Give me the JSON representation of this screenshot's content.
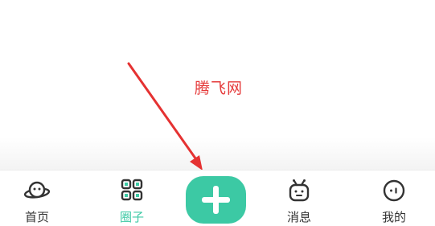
{
  "watermark": {
    "text": "腾飞网",
    "color": "#e53a3a"
  },
  "annotation": {
    "icon": "red-arrow",
    "color": "#e53232"
  },
  "tabbar": {
    "accent_color": "#3cc9a4",
    "items": [
      {
        "label": "首页",
        "icon": "planet-face-icon",
        "active": false
      },
      {
        "label": "圈子",
        "icon": "grid-four-icon",
        "active": true
      },
      {
        "label": "",
        "icon": "plus-icon",
        "active": false
      },
      {
        "label": "消息",
        "icon": "robot-face-icon",
        "active": false
      },
      {
        "label": "我的",
        "icon": "smiley-circle-icon",
        "active": false
      }
    ]
  }
}
